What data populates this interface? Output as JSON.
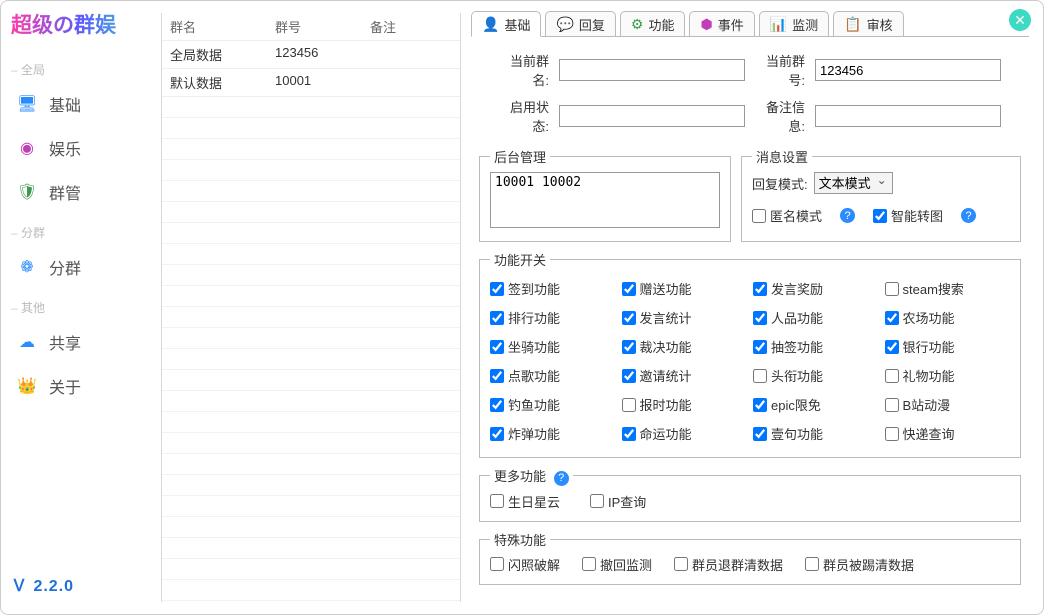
{
  "app": {
    "title": "超级の群娱",
    "version": "Ｖ 2.2.0"
  },
  "sidebar": {
    "groups": [
      {
        "label": "全局",
        "items": [
          {
            "label": "基础",
            "icon": "monitor-icon"
          },
          {
            "label": "娱乐",
            "icon": "target-icon"
          },
          {
            "label": "群管",
            "icon": "shield-icon"
          }
        ]
      },
      {
        "label": "分群",
        "items": [
          {
            "label": "分群",
            "icon": "cloud-outline-icon"
          }
        ]
      },
      {
        "label": "其他",
        "items": [
          {
            "label": "共享",
            "icon": "cloud-icon"
          },
          {
            "label": "关于",
            "icon": "crown-icon"
          }
        ]
      }
    ]
  },
  "group_table": {
    "headers": {
      "name": "群名",
      "number": "群号",
      "note": "备注"
    },
    "rows": [
      {
        "name": "全局数据",
        "number": "123456",
        "note": ""
      },
      {
        "name": "默认数据",
        "number": "10001",
        "note": ""
      }
    ]
  },
  "tabs": [
    {
      "label": "基础",
      "icon": "person-icon"
    },
    {
      "label": "回复",
      "icon": "chat-icon"
    },
    {
      "label": "功能",
      "icon": "gear-icon"
    },
    {
      "label": "事件",
      "icon": "cube-icon"
    },
    {
      "label": "监测",
      "icon": "chart-icon"
    },
    {
      "label": "审核",
      "icon": "clipboard-icon"
    }
  ],
  "form": {
    "group_name_label": "当前群名:",
    "group_name_value": "",
    "group_number_label": "当前群号:",
    "group_number_value": "123456",
    "enable_state_label": "启用状态:",
    "enable_state_value": "",
    "remark_label": "备注信息:",
    "remark_value": ""
  },
  "backend": {
    "legend": "后台管理",
    "value": "10001 10002"
  },
  "msg": {
    "legend": "消息设置",
    "reply_mode_label": "回复模式:",
    "reply_mode_value": "文本模式",
    "anon_label": "匿名模式",
    "anon_checked": false,
    "smart_label": "智能转图",
    "smart_checked": true
  },
  "func_switch": {
    "legend": "功能开关",
    "items": [
      {
        "label": "签到功能",
        "checked": true
      },
      {
        "label": "赠送功能",
        "checked": true
      },
      {
        "label": "发言奖励",
        "checked": true
      },
      {
        "label": "steam搜索",
        "checked": false
      },
      {
        "label": "排行功能",
        "checked": true
      },
      {
        "label": "发言统计",
        "checked": true
      },
      {
        "label": "人品功能",
        "checked": true
      },
      {
        "label": "农场功能",
        "checked": true
      },
      {
        "label": "坐骑功能",
        "checked": true
      },
      {
        "label": "裁决功能",
        "checked": true
      },
      {
        "label": "抽签功能",
        "checked": true
      },
      {
        "label": "银行功能",
        "checked": true
      },
      {
        "label": "点歌功能",
        "checked": true
      },
      {
        "label": "邀请统计",
        "checked": true
      },
      {
        "label": "头衔功能",
        "checked": false
      },
      {
        "label": "礼物功能",
        "checked": false
      },
      {
        "label": "钓鱼功能",
        "checked": true
      },
      {
        "label": "报时功能",
        "checked": false
      },
      {
        "label": "epic限免",
        "checked": true
      },
      {
        "label": "B站动漫",
        "checked": false
      },
      {
        "label": "炸弹功能",
        "checked": true
      },
      {
        "label": "命运功能",
        "checked": true
      },
      {
        "label": "壹句功能",
        "checked": true
      },
      {
        "label": "快递查询",
        "checked": false
      }
    ]
  },
  "more_func": {
    "legend": "更多功能",
    "items": [
      {
        "label": "生日星云",
        "checked": false
      },
      {
        "label": "IP查询",
        "checked": false
      }
    ]
  },
  "special_func": {
    "legend": "特殊功能",
    "items": [
      {
        "label": "闪照破解",
        "checked": false
      },
      {
        "label": "撤回监测",
        "checked": false
      },
      {
        "label": "群员退群清数据",
        "checked": false
      },
      {
        "label": "群员被踢清数据",
        "checked": false
      }
    ]
  }
}
